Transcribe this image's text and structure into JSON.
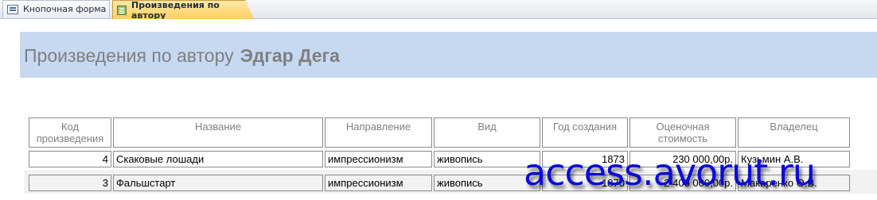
{
  "tabs": [
    {
      "label": "Кнопочная форма",
      "icon": "form-icon",
      "active": false
    },
    {
      "label": "Произведения по автору",
      "icon": "report-icon",
      "active": true
    }
  ],
  "report": {
    "title": "Произведения по автору",
    "author": "Эдгар Дега"
  },
  "table": {
    "columns": [
      "Код произведения",
      "Название",
      "Направление",
      "Вид",
      "Год создания",
      "Оценочная стоимость",
      "Владелец"
    ],
    "rows": [
      {
        "code": "4",
        "name": "Скаковые лошади",
        "direction": "импрессионизм",
        "kind": "живопись",
        "year": "1873",
        "value": "230 000,00р.",
        "owner": "Кузьмин А.В."
      },
      {
        "code": "3",
        "name": "Фальшстарт",
        "direction": "импрессионизм",
        "kind": "живопись",
        "year": "1870",
        "value": "2 400 000,00р.",
        "owner": "Макаренко О.В."
      }
    ]
  },
  "watermark": "access.avorut.ru",
  "colors": {
    "header_band": "#c6d9f1",
    "active_tab": "#ffce5c",
    "watermark": "#0a0ad8"
  }
}
